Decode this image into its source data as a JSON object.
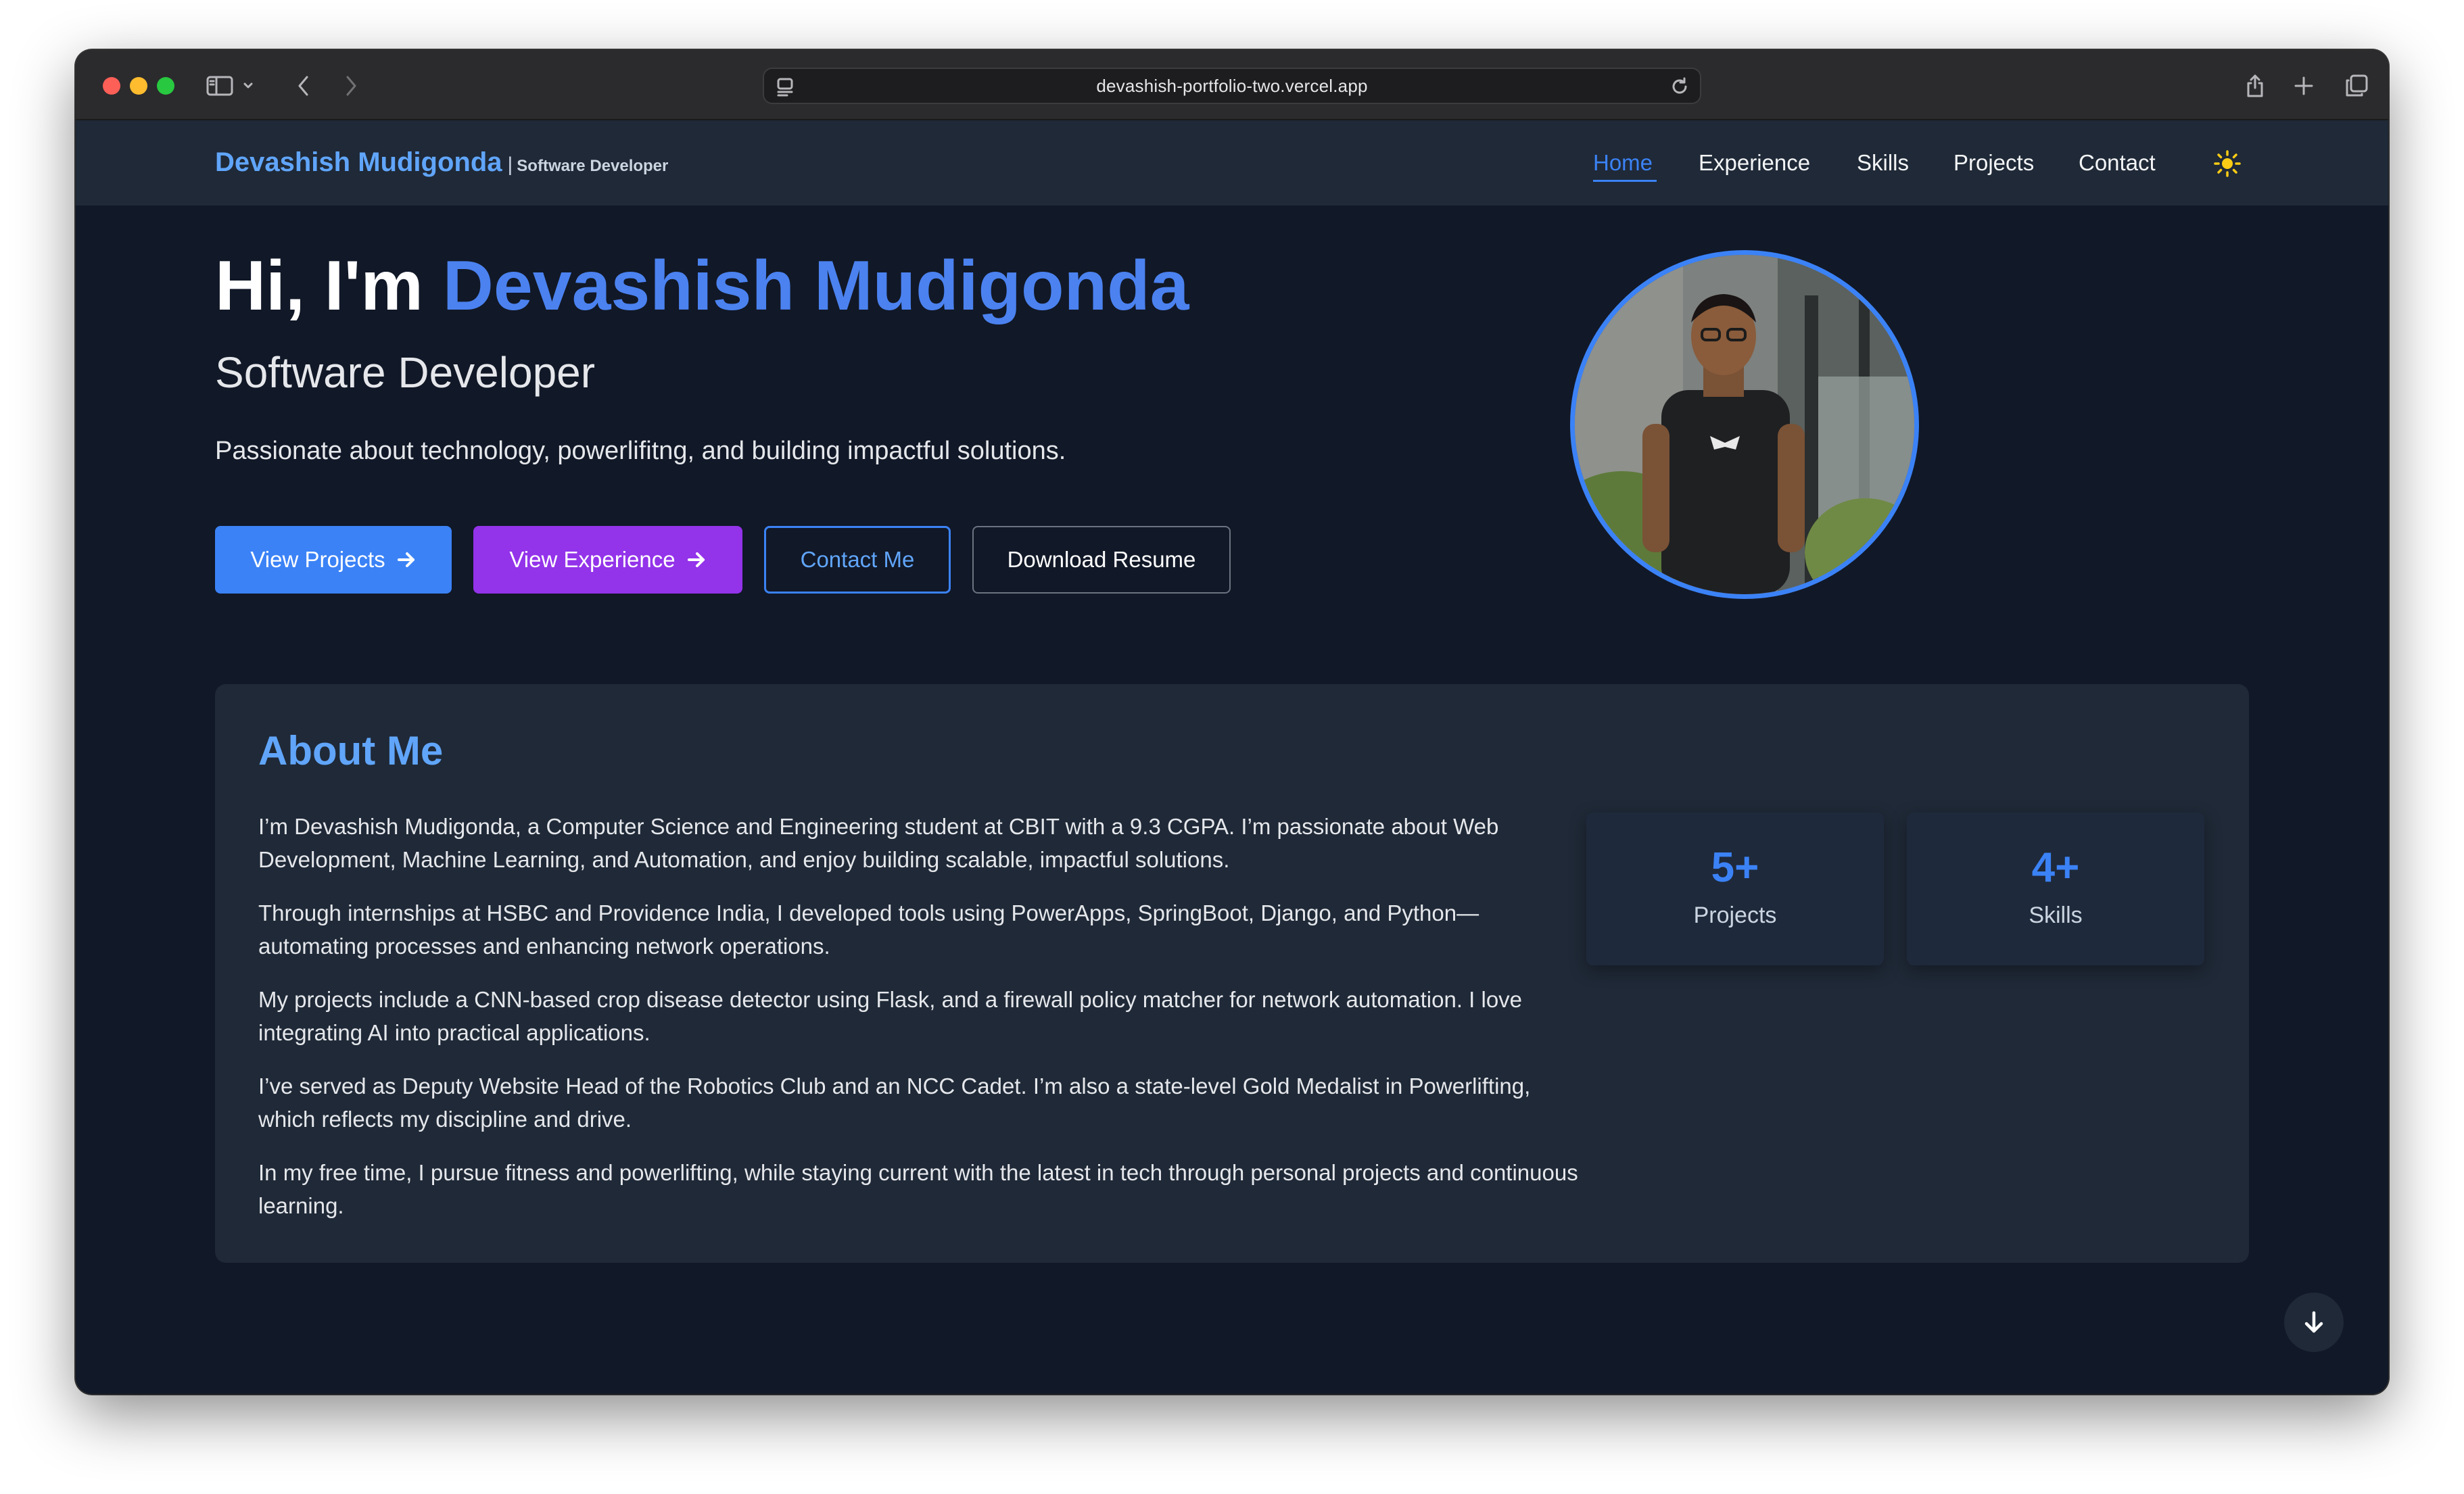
{
  "browser": {
    "url": "devashish-portfolio-two.vercel.app",
    "icons": [
      "sidebar-icon",
      "chevron-down-icon",
      "back-icon",
      "forward-icon",
      "page-icon",
      "reload-icon",
      "share-icon",
      "new-tab-icon",
      "tabs-overview-icon"
    ]
  },
  "nav": {
    "brand_name": "Devashish Mudigonda",
    "brand_separator": "|",
    "brand_role": "Software Developer",
    "links": [
      {
        "label": "Home",
        "active": true
      },
      {
        "label": "Experience",
        "active": false
      },
      {
        "label": "Skills",
        "active": false
      },
      {
        "label": "Projects",
        "active": false
      },
      {
        "label": "Contact",
        "active": false
      }
    ],
    "theme_icon": "sun-icon"
  },
  "hero": {
    "greeting": "Hi, I'm",
    "name": "Devashish Mudigonda",
    "role": "Software Developer",
    "description": "Passionate about technology, powerlifitng, and building impactful solutions.",
    "buttons": {
      "projects": "View Projects",
      "experience": "View Experience",
      "contact": "Contact Me",
      "resume": "Download Resume"
    }
  },
  "about": {
    "title": "About Me",
    "paragraphs": [
      "I’m Devashish Mudigonda, a Computer Science and Engineering student at CBIT with a 9.3 CGPA. I’m passionate about Web Development, Machine Learning, and Automation, and enjoy building scalable, impactful solutions.",
      "Through internships at HSBC and Providence India, I developed tools using PowerApps, SpringBoot, Django, and Python—automating processes and enhancing network operations.",
      "My projects include a CNN-based crop disease detector using Flask, and a firewall policy matcher for network automation. I love integrating AI into practical applications.",
      "I’ve served as Deputy Website Head of the Robotics Club and an NCC Cadet. I’m also a state-level Gold Medalist in Powerlifting, which reflects my discipline and drive.",
      "In my free time, I pursue fitness and powerlifting, while staying current with the latest in tech through personal projects and continuous learning."
    ],
    "stats": [
      {
        "value": "5+",
        "label": "Projects"
      },
      {
        "value": "4+",
        "label": "Skills"
      }
    ]
  },
  "colors": {
    "page_bg": "#111827",
    "nav_bg": "#1f2937",
    "accent": "#3b82f6",
    "purple": "#9333ea"
  }
}
